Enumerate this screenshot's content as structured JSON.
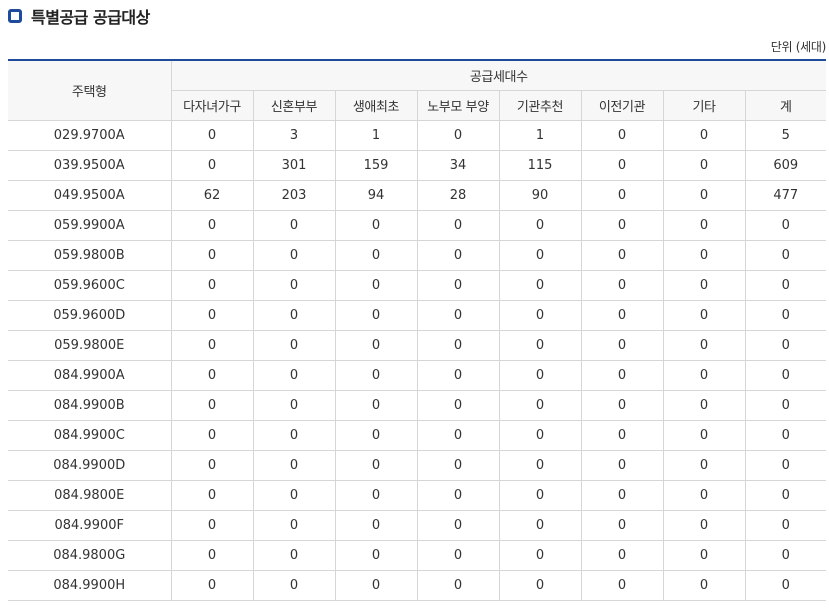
{
  "title": "특별공급 공급대상",
  "unit_label": "단위 (세대)",
  "table": {
    "housing_type_header": "주택형",
    "group_header": "공급세대수",
    "columns": [
      "다자녀가구",
      "신혼부부",
      "생애최초",
      "노부모 부양",
      "기관추천",
      "이전기관",
      "기타",
      "계"
    ],
    "rows": [
      {
        "type": "029.9700A",
        "values": [
          "0",
          "3",
          "1",
          "0",
          "1",
          "0",
          "0",
          "5"
        ]
      },
      {
        "type": "039.9500A",
        "values": [
          "0",
          "301",
          "159",
          "34",
          "115",
          "0",
          "0",
          "609"
        ]
      },
      {
        "type": "049.9500A",
        "values": [
          "62",
          "203",
          "94",
          "28",
          "90",
          "0",
          "0",
          "477"
        ]
      },
      {
        "type": "059.9900A",
        "values": [
          "0",
          "0",
          "0",
          "0",
          "0",
          "0",
          "0",
          "0"
        ]
      },
      {
        "type": "059.9800B",
        "values": [
          "0",
          "0",
          "0",
          "0",
          "0",
          "0",
          "0",
          "0"
        ]
      },
      {
        "type": "059.9600C",
        "values": [
          "0",
          "0",
          "0",
          "0",
          "0",
          "0",
          "0",
          "0"
        ]
      },
      {
        "type": "059.9600D",
        "values": [
          "0",
          "0",
          "0",
          "0",
          "0",
          "0",
          "0",
          "0"
        ]
      },
      {
        "type": "059.9800E",
        "values": [
          "0",
          "0",
          "0",
          "0",
          "0",
          "0",
          "0",
          "0"
        ]
      },
      {
        "type": "084.9900A",
        "values": [
          "0",
          "0",
          "0",
          "0",
          "0",
          "0",
          "0",
          "0"
        ]
      },
      {
        "type": "084.9900B",
        "values": [
          "0",
          "0",
          "0",
          "0",
          "0",
          "0",
          "0",
          "0"
        ]
      },
      {
        "type": "084.9900C",
        "values": [
          "0",
          "0",
          "0",
          "0",
          "0",
          "0",
          "0",
          "0"
        ]
      },
      {
        "type": "084.9900D",
        "values": [
          "0",
          "0",
          "0",
          "0",
          "0",
          "0",
          "0",
          "0"
        ]
      },
      {
        "type": "084.9800E",
        "values": [
          "0",
          "0",
          "0",
          "0",
          "0",
          "0",
          "0",
          "0"
        ]
      },
      {
        "type": "084.9900F",
        "values": [
          "0",
          "0",
          "0",
          "0",
          "0",
          "0",
          "0",
          "0"
        ]
      },
      {
        "type": "084.9800G",
        "values": [
          "0",
          "0",
          "0",
          "0",
          "0",
          "0",
          "0",
          "0"
        ]
      },
      {
        "type": "084.9900H",
        "values": [
          "0",
          "0",
          "0",
          "0",
          "0",
          "0",
          "0",
          "0"
        ]
      }
    ]
  },
  "colors": {
    "accent": "#1f4b9b",
    "header_bg": "#f7f7f7",
    "border": "#d6d6d6"
  },
  "icons": {
    "title_bullet": "square-bullet-icon"
  }
}
